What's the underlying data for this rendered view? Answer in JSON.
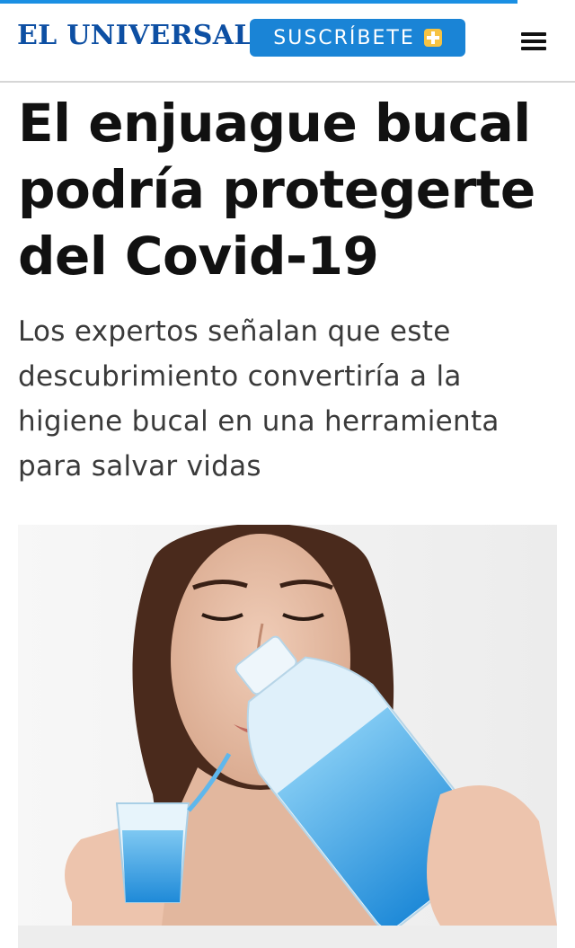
{
  "header": {
    "logo_text": "EL UNIVERSAL",
    "subscribe_label": "SUSCRÍBETE",
    "brand_color": "#0d4fa3",
    "accent_color": "#1a84d6",
    "icons": [
      "plus-icon",
      "menu-icon"
    ]
  },
  "article": {
    "headline": "El enjuague bucal podría protegerte del Covid-19",
    "subtitle": "Los expertos señalan que este descubrimiento convertiría a la higiene bucal en una herramienta para salvar vidas"
  }
}
